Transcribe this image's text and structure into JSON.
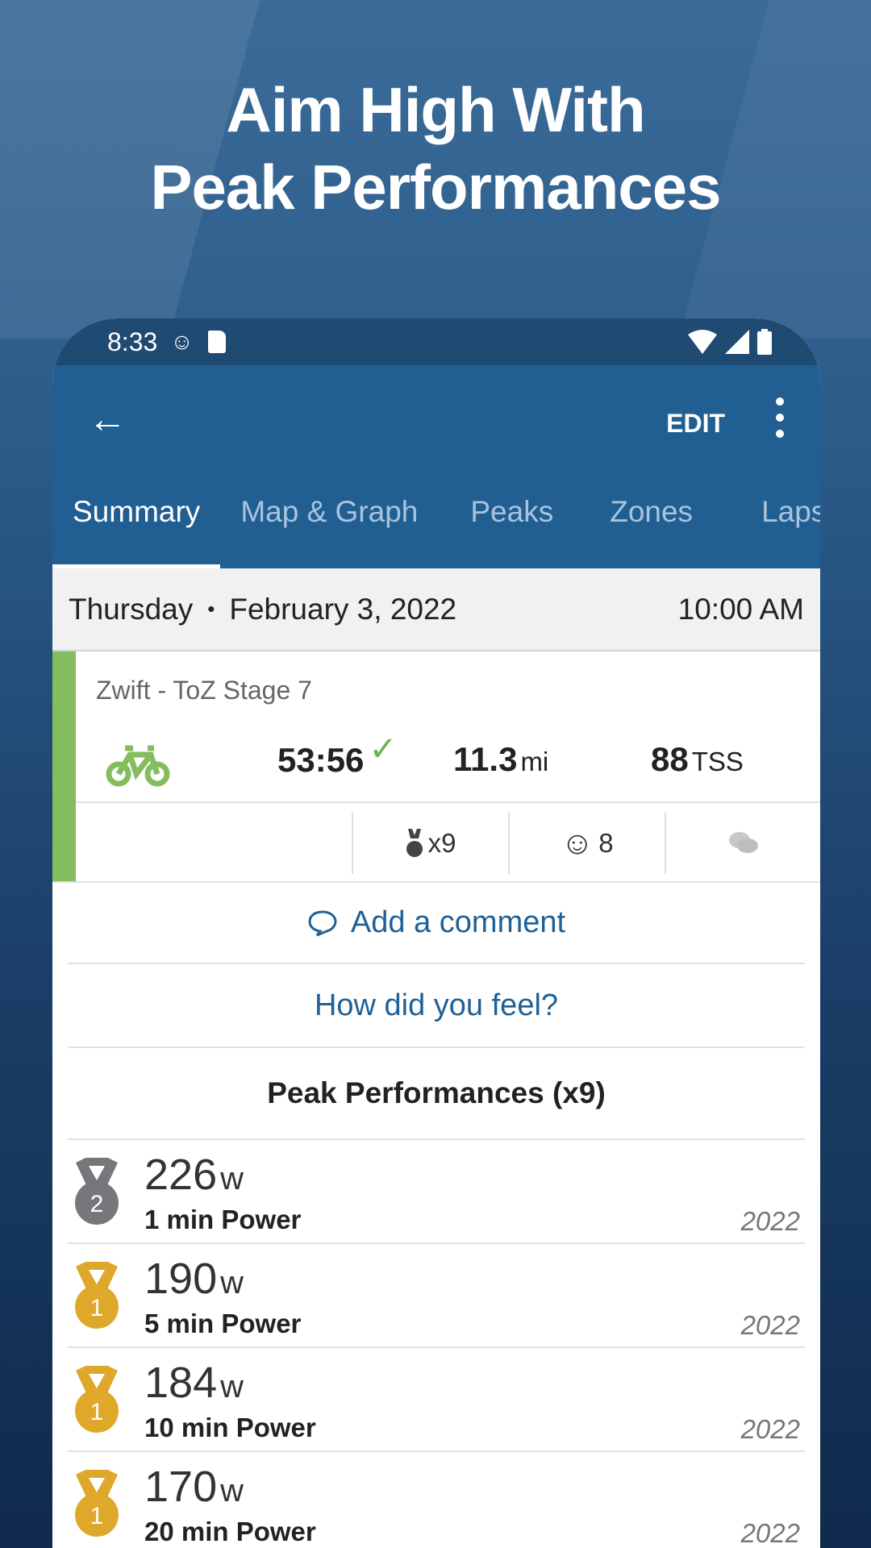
{
  "headline": {
    "line1": "Aim High With",
    "line2": "Peak Performances"
  },
  "status_bar": {
    "time": "8:33",
    "icons": [
      "debug-icon",
      "sd-card-icon",
      "wifi-icon",
      "signal-icon",
      "battery-icon"
    ]
  },
  "toolbar": {
    "edit_label": "EDIT"
  },
  "tabs": [
    {
      "label": "Summary",
      "active": true
    },
    {
      "label": "Map & Graph"
    },
    {
      "label": "Peaks"
    },
    {
      "label": "Zones"
    },
    {
      "label": "Laps"
    }
  ],
  "date_row": {
    "day": "Thursday",
    "separator": "•",
    "date": "February 3, 2022",
    "time": "10:00 AM"
  },
  "workout": {
    "title": "Zwift - ToZ Stage 7",
    "sport_icon": "bike-icon",
    "sport_color": "#84bd5e",
    "duration": "53:56",
    "distance": "11.3",
    "distance_unit": "mi",
    "tss": "88",
    "tss_unit": "TSS",
    "medals_count": "x9",
    "feel_count": "8"
  },
  "actions": {
    "add_comment": "Add a comment",
    "how_feel": "How did you feel?"
  },
  "peaks": {
    "title": "Peak Performances (x9)",
    "items": [
      {
        "rank": "2",
        "medal_color": "#76777b",
        "value": "226",
        "unit": "w",
        "label": "1 min Power",
        "year": "2022"
      },
      {
        "rank": "1",
        "medal_color": "#e0a82a",
        "value": "190",
        "unit": "w",
        "label": "5 min Power",
        "year": "2022"
      },
      {
        "rank": "1",
        "medal_color": "#e0a82a",
        "value": "184",
        "unit": "w",
        "label": "10 min Power",
        "year": "2022"
      },
      {
        "rank": "1",
        "medal_color": "#e0a82a",
        "value": "170",
        "unit": "w",
        "label": "20 min Power",
        "year": "2022"
      }
    ]
  }
}
